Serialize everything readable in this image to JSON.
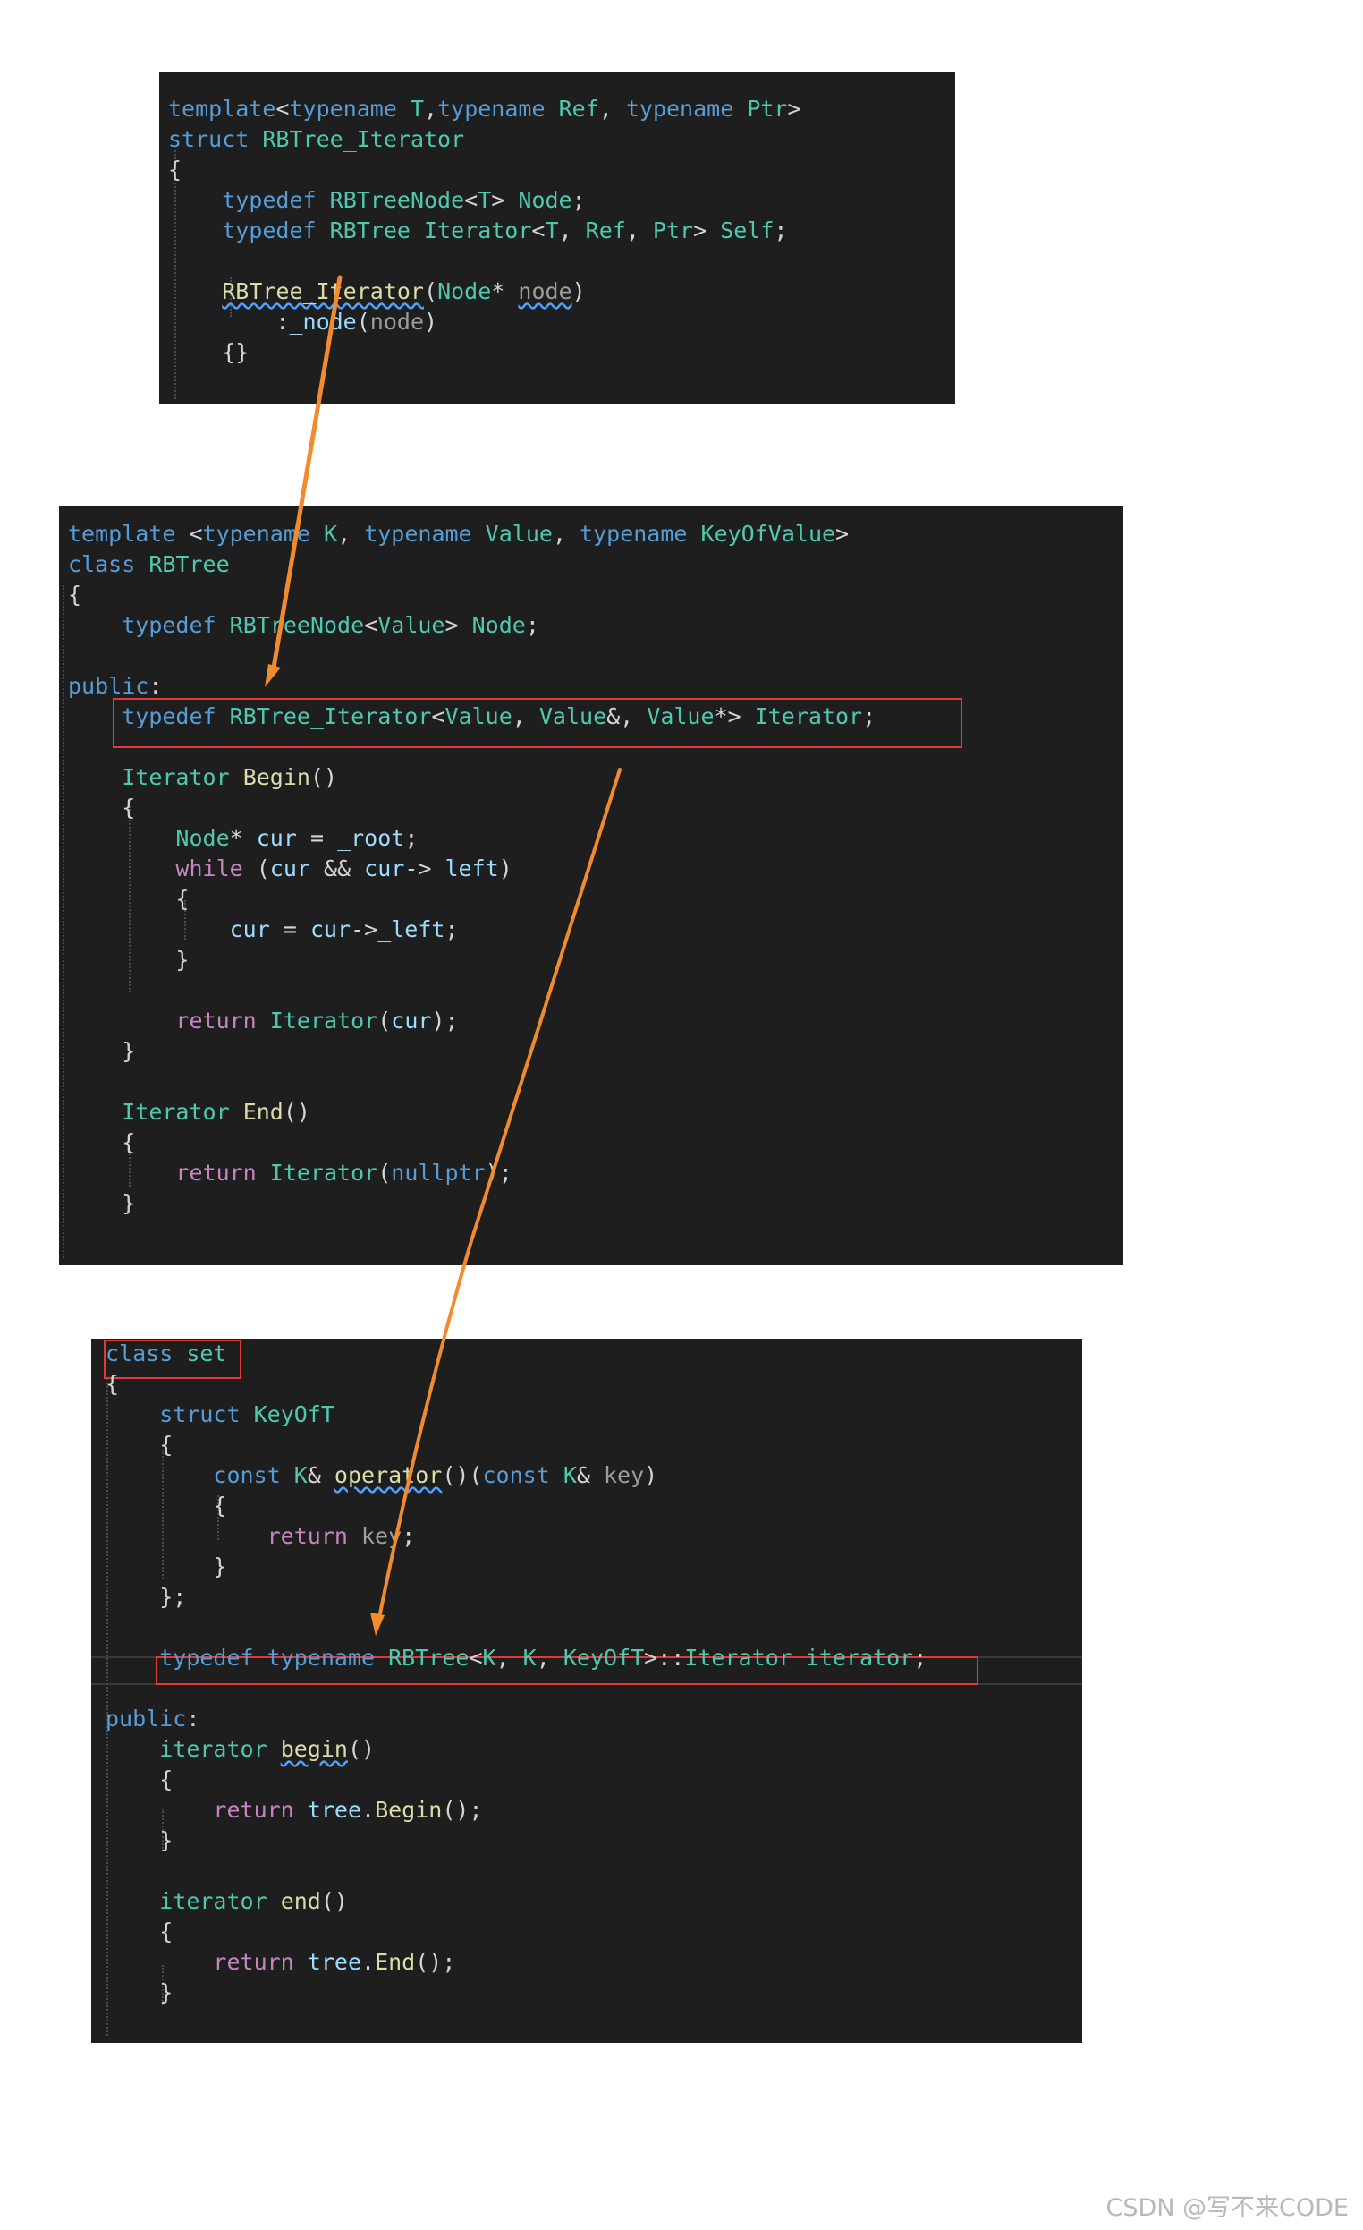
{
  "panel1": {
    "lines": [
      [
        [
          "kw",
          "template"
        ],
        [
          "pl",
          "<"
        ],
        [
          "kw",
          "typename"
        ],
        [
          "pl",
          " "
        ],
        [
          "ty",
          "T"
        ],
        [
          "pl",
          ","
        ],
        [
          "kw",
          "typename"
        ],
        [
          "pl",
          " "
        ],
        [
          "ty",
          "Ref"
        ],
        [
          "pl",
          ", "
        ],
        [
          "kw",
          "typename"
        ],
        [
          "pl",
          " "
        ],
        [
          "ty",
          "Ptr"
        ],
        [
          "pl",
          ">"
        ]
      ],
      [
        [
          "kw",
          "struct"
        ],
        [
          "pl",
          " "
        ],
        [
          "ty",
          "RBTree_Iterator"
        ]
      ],
      [
        [
          "pl",
          "{"
        ]
      ],
      [
        [
          "pl",
          "    "
        ],
        [
          "kw",
          "typedef"
        ],
        [
          "pl",
          " "
        ],
        [
          "ty",
          "RBTreeNode"
        ],
        [
          "pl",
          "<"
        ],
        [
          "ty",
          "T"
        ],
        [
          "pl",
          "> "
        ],
        [
          "ty",
          "Node"
        ],
        [
          "pl",
          ";"
        ]
      ],
      [
        [
          "pl",
          "    "
        ],
        [
          "kw",
          "typedef"
        ],
        [
          "pl",
          " "
        ],
        [
          "ty",
          "RBTree_Iterator"
        ],
        [
          "pl",
          "<"
        ],
        [
          "ty",
          "T"
        ],
        [
          "pl",
          ", "
        ],
        [
          "ty",
          "Ref"
        ],
        [
          "pl",
          ", "
        ],
        [
          "ty",
          "Ptr"
        ],
        [
          "pl",
          "> "
        ],
        [
          "ty",
          "Self"
        ],
        [
          "pl",
          ";"
        ]
      ],
      [],
      [
        [
          "pl",
          "    "
        ],
        [
          "fn",
          "RBTree_Iterator",
          "wavy"
        ],
        [
          "pl",
          "("
        ],
        [
          "ty",
          "Node"
        ],
        [
          "pl",
          "* "
        ],
        [
          "dim",
          "node",
          "wavy"
        ],
        [
          "pl",
          ")"
        ]
      ],
      [
        [
          "pl",
          "        :"
        ],
        [
          "var",
          "_node"
        ],
        [
          "pl",
          "("
        ],
        [
          "dim",
          "node"
        ],
        [
          "pl",
          ")"
        ]
      ],
      [
        [
          "pl",
          "    {}"
        ]
      ]
    ]
  },
  "panel2": {
    "lines": [
      [
        [
          "kw",
          "template"
        ],
        [
          "pl",
          " <"
        ],
        [
          "kw",
          "typename"
        ],
        [
          "pl",
          " "
        ],
        [
          "ty",
          "K"
        ],
        [
          "pl",
          ", "
        ],
        [
          "kw",
          "typename"
        ],
        [
          "pl",
          " "
        ],
        [
          "ty",
          "Value"
        ],
        [
          "pl",
          ", "
        ],
        [
          "kw",
          "typename"
        ],
        [
          "pl",
          " "
        ],
        [
          "ty",
          "KeyOfValue"
        ],
        [
          "pl",
          ">"
        ]
      ],
      [
        [
          "kw",
          "class"
        ],
        [
          "pl",
          " "
        ],
        [
          "ty",
          "RBTree"
        ]
      ],
      [
        [
          "pl",
          "{"
        ]
      ],
      [
        [
          "pl",
          "    "
        ],
        [
          "kw",
          "typedef"
        ],
        [
          "pl",
          " "
        ],
        [
          "ty",
          "RBTreeNode"
        ],
        [
          "pl",
          "<"
        ],
        [
          "ty",
          "Value"
        ],
        [
          "pl",
          "> "
        ],
        [
          "ty",
          "Node"
        ],
        [
          "pl",
          ";"
        ]
      ],
      [],
      [
        [
          "kw",
          "public"
        ],
        [
          "pl",
          ":"
        ]
      ],
      [
        [
          "pl",
          "    "
        ],
        [
          "kw",
          "typedef"
        ],
        [
          "pl",
          " "
        ],
        [
          "ty",
          "RBTree_Iterator"
        ],
        [
          "pl",
          "<"
        ],
        [
          "ty",
          "Value"
        ],
        [
          "pl",
          ", "
        ],
        [
          "ty",
          "Value"
        ],
        [
          "pl",
          "&, "
        ],
        [
          "ty",
          "Value"
        ],
        [
          "pl",
          "*> "
        ],
        [
          "ty",
          "Iterator"
        ],
        [
          "pl",
          ";"
        ]
      ],
      [],
      [
        [
          "pl",
          "    "
        ],
        [
          "ty",
          "Iterator"
        ],
        [
          "pl",
          " "
        ],
        [
          "fn",
          "Begin"
        ],
        [
          "pl",
          "()"
        ]
      ],
      [
        [
          "pl",
          "    {"
        ]
      ],
      [
        [
          "pl",
          "        "
        ],
        [
          "ty",
          "Node"
        ],
        [
          "pl",
          "* "
        ],
        [
          "var",
          "cur"
        ],
        [
          "pl",
          " = "
        ],
        [
          "var",
          "_root"
        ],
        [
          "pl",
          ";"
        ]
      ],
      [
        [
          "pl",
          "        "
        ],
        [
          "ctl",
          "while"
        ],
        [
          "pl",
          " ("
        ],
        [
          "var",
          "cur"
        ],
        [
          "pl",
          " && "
        ],
        [
          "var",
          "cur"
        ],
        [
          "pl",
          "->"
        ],
        [
          "var",
          "_left"
        ],
        [
          "pl",
          ")"
        ]
      ],
      [
        [
          "pl",
          "        {"
        ]
      ],
      [
        [
          "pl",
          "            "
        ],
        [
          "var",
          "cur"
        ],
        [
          "pl",
          " = "
        ],
        [
          "var",
          "cur"
        ],
        [
          "pl",
          "->"
        ],
        [
          "var",
          "_left"
        ],
        [
          "pl",
          ";"
        ]
      ],
      [
        [
          "pl",
          "        }"
        ]
      ],
      [],
      [
        [
          "pl",
          "        "
        ],
        [
          "ctl",
          "return"
        ],
        [
          "pl",
          " "
        ],
        [
          "ty",
          "Iterator"
        ],
        [
          "pl",
          "("
        ],
        [
          "var",
          "cur"
        ],
        [
          "pl",
          ");"
        ]
      ],
      [
        [
          "pl",
          "    }"
        ]
      ],
      [],
      [
        [
          "pl",
          "    "
        ],
        [
          "ty",
          "Iterator"
        ],
        [
          "pl",
          " "
        ],
        [
          "fn",
          "End"
        ],
        [
          "pl",
          "()"
        ]
      ],
      [
        [
          "pl",
          "    {"
        ]
      ],
      [
        [
          "pl",
          "        "
        ],
        [
          "ctl",
          "return"
        ],
        [
          "pl",
          " "
        ],
        [
          "ty",
          "Iterator"
        ],
        [
          "pl",
          "("
        ],
        [
          "kw",
          "nullptr"
        ],
        [
          "pl",
          ");"
        ]
      ],
      [
        [
          "pl",
          "    }"
        ]
      ]
    ]
  },
  "panel3": {
    "lines": [
      [
        [
          "kw",
          "class"
        ],
        [
          "pl",
          " "
        ],
        [
          "ty",
          "set"
        ]
      ],
      [
        [
          "pl",
          "{"
        ]
      ],
      [
        [
          "pl",
          "    "
        ],
        [
          "kw",
          "struct"
        ],
        [
          "pl",
          " "
        ],
        [
          "ty",
          "KeyOfT"
        ]
      ],
      [
        [
          "pl",
          "    {"
        ]
      ],
      [
        [
          "pl",
          "        "
        ],
        [
          "kw",
          "const"
        ],
        [
          "pl",
          " "
        ],
        [
          "ty",
          "K"
        ],
        [
          "pl",
          "& "
        ],
        [
          "fn",
          "operator",
          "wavy"
        ],
        [
          "pl",
          "()("
        ],
        [
          "kw",
          "const"
        ],
        [
          "pl",
          " "
        ],
        [
          "ty",
          "K"
        ],
        [
          "pl",
          "& "
        ],
        [
          "dim",
          "key"
        ],
        [
          "pl",
          ")"
        ]
      ],
      [
        [
          "pl",
          "        {"
        ]
      ],
      [
        [
          "pl",
          "            "
        ],
        [
          "ctl",
          "return"
        ],
        [
          "pl",
          " "
        ],
        [
          "dim",
          "key"
        ],
        [
          "pl",
          ";"
        ]
      ],
      [
        [
          "pl",
          "        }"
        ]
      ],
      [
        [
          "pl",
          "    };"
        ]
      ],
      [],
      [
        [
          "pl",
          "    "
        ],
        [
          "kw",
          "typedef"
        ],
        [
          "pl",
          " "
        ],
        [
          "kw",
          "typename"
        ],
        [
          "pl",
          " "
        ],
        [
          "ty",
          "RBTree"
        ],
        [
          "pl",
          "<"
        ],
        [
          "ty",
          "K"
        ],
        [
          "pl",
          ", "
        ],
        [
          "ty",
          "K"
        ],
        [
          "pl",
          ", "
        ],
        [
          "ty",
          "KeyOfT"
        ],
        [
          "pl",
          ">::"
        ],
        [
          "ty",
          "Iterator"
        ],
        [
          "pl",
          " "
        ],
        [
          "ty",
          "iterator"
        ],
        [
          "pl",
          ";"
        ]
      ],
      [],
      [
        [
          "kw",
          "public"
        ],
        [
          "pl",
          ":"
        ]
      ],
      [
        [
          "pl",
          "    "
        ],
        [
          "ty",
          "iterator"
        ],
        [
          "pl",
          " "
        ],
        [
          "fn",
          "begin",
          "wavy"
        ],
        [
          "pl",
          "()"
        ]
      ],
      [
        [
          "pl",
          "    {"
        ]
      ],
      [
        [
          "pl",
          "        "
        ],
        [
          "ctl",
          "return"
        ],
        [
          "pl",
          " "
        ],
        [
          "var",
          "tree"
        ],
        [
          "pl",
          "."
        ],
        [
          "fn",
          "Begin"
        ],
        [
          "pl",
          "();"
        ]
      ],
      [
        [
          "pl",
          "    }"
        ]
      ],
      [],
      [
        [
          "pl",
          "    "
        ],
        [
          "ty",
          "iterator"
        ],
        [
          "pl",
          " "
        ],
        [
          "fn",
          "end"
        ],
        [
          "pl",
          "()"
        ]
      ],
      [
        [
          "pl",
          "    {"
        ]
      ],
      [
        [
          "pl",
          "        "
        ],
        [
          "ctl",
          "return"
        ],
        [
          "pl",
          " "
        ],
        [
          "var",
          "tree"
        ],
        [
          "pl",
          "."
        ],
        [
          "fn",
          "End"
        ],
        [
          "pl",
          "();"
        ]
      ],
      [
        [
          "pl",
          "    }"
        ]
      ]
    ]
  },
  "watermark": "CSDN @写不来CODE",
  "colors": {
    "editor_bg": "#1e1e1e",
    "keyword": "#569cd6",
    "type": "#4ec9b0",
    "function": "#dcdcaa",
    "variable": "#9cdcfe",
    "control": "#c586c0",
    "plain": "#d4d4d4",
    "highlight_box": "#e53935",
    "arrow": "#f28a2e"
  }
}
